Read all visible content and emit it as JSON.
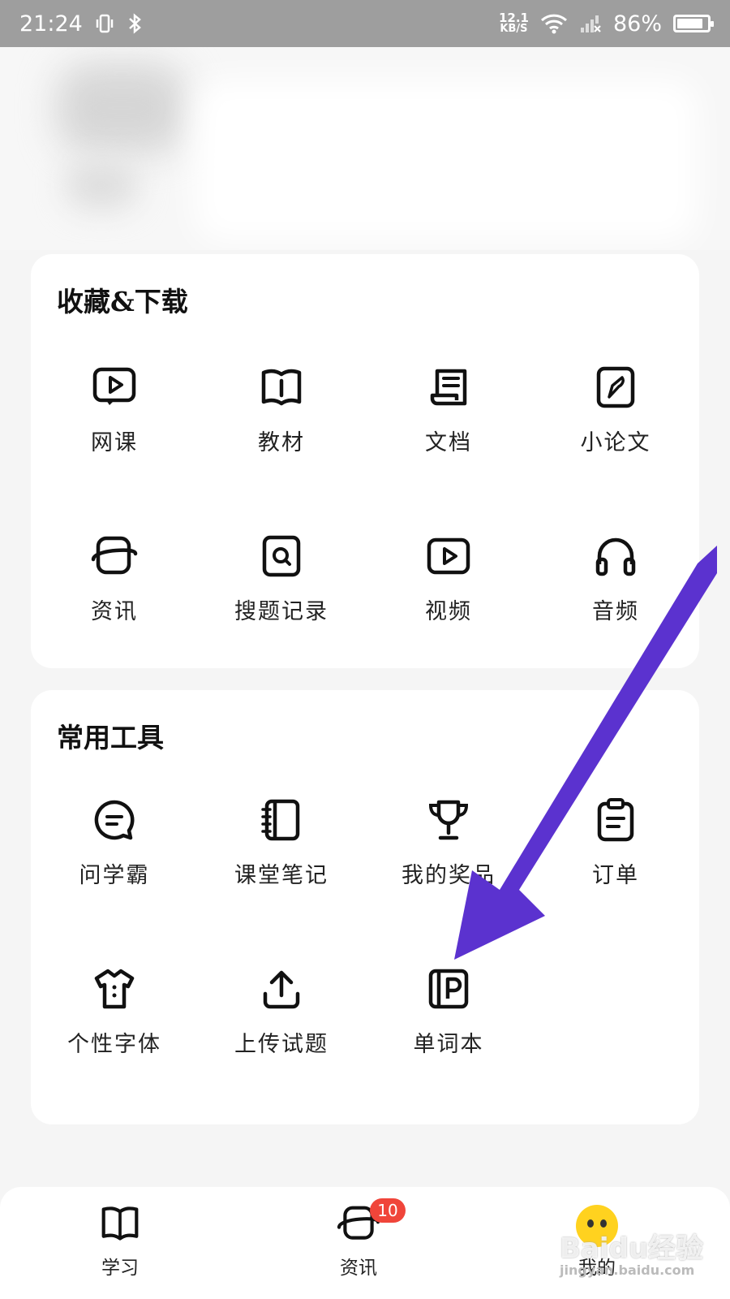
{
  "status_bar": {
    "time": "21:24",
    "net_speed_value": "12.1",
    "net_speed_unit": "KB/S",
    "battery": "86%",
    "battery_level": 0.86
  },
  "collect_section": {
    "title": "收藏&下载",
    "items": [
      {
        "label": "网课",
        "icon": "video-bubble-icon"
      },
      {
        "label": "教材",
        "icon": "book-icon"
      },
      {
        "label": "文档",
        "icon": "scroll-document-icon"
      },
      {
        "label": "小论文",
        "icon": "pen-nib-icon"
      },
      {
        "label": "资讯",
        "icon": "planet-icon"
      },
      {
        "label": "搜题记录",
        "icon": "search-box-icon"
      },
      {
        "label": "视频",
        "icon": "play-icon"
      },
      {
        "label": "音频",
        "icon": "headphones-icon"
      }
    ]
  },
  "tools_section": {
    "title": "常用工具",
    "items": [
      {
        "label": "问学霸",
        "icon": "chat-bubble-icon"
      },
      {
        "label": "课堂笔记",
        "icon": "notebook-icon"
      },
      {
        "label": "我的奖品",
        "icon": "trophy-icon"
      },
      {
        "label": "订单",
        "icon": "clipboard-icon"
      },
      {
        "label": "个性字体",
        "icon": "shirt-icon"
      },
      {
        "label": "上传试题",
        "icon": "upload-icon"
      },
      {
        "label": "单词本",
        "icon": "word-book-icon"
      }
    ]
  },
  "tab_bar": {
    "tabs": [
      {
        "label": "学习",
        "icon": "book-icon"
      },
      {
        "label": "资讯",
        "icon": "planet-icon",
        "badge": "10"
      },
      {
        "label": "我的",
        "icon": "avatar-icon"
      }
    ]
  },
  "watermark": {
    "text": "Baidu经验",
    "url": "jingyan.baidu.com"
  },
  "colors": {
    "arrow": "#5b32cf",
    "badge": "#f0453a",
    "avatar": "#ffd21f"
  }
}
